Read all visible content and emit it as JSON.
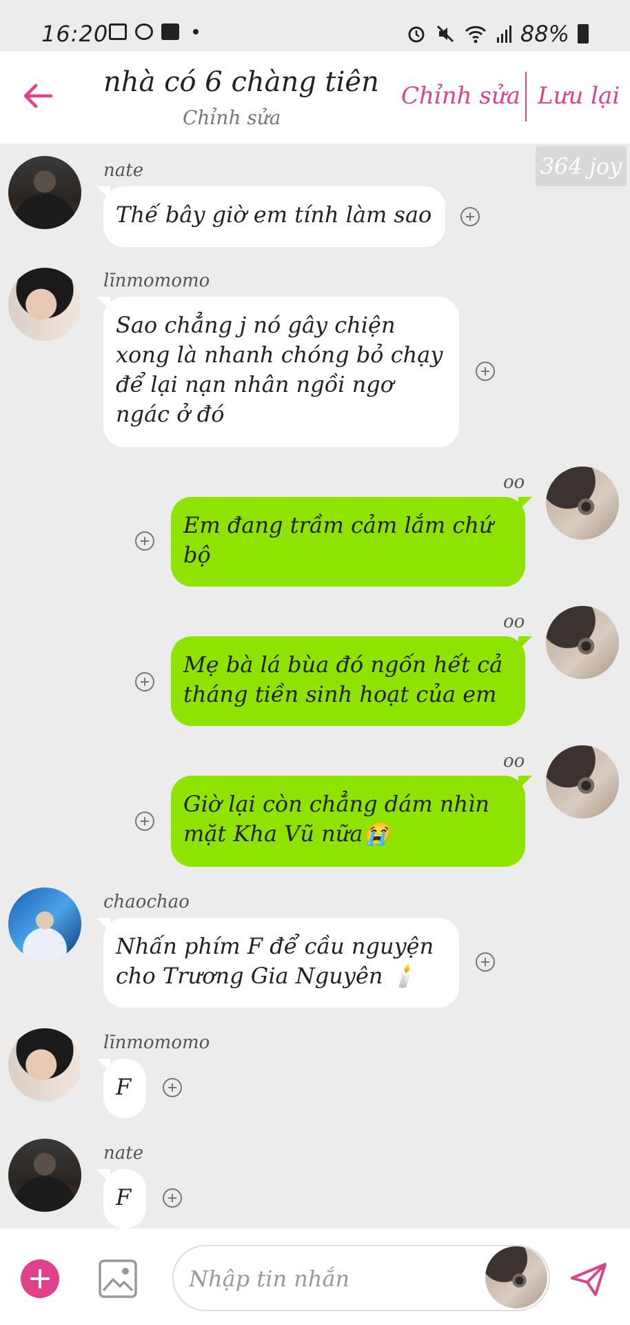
{
  "status_bar": {
    "time": "16:20",
    "battery": "88%"
  },
  "header": {
    "title": "nhà có 6 chàng tiên",
    "subtitle": "Chỉnh sửa",
    "edit_button": "Chỉnh sửa",
    "save_button": "Lưu lại"
  },
  "badge": "364 joy",
  "messages": [
    {
      "sender": "nate",
      "text": "Thế bây giờ em tính làm sao"
    },
    {
      "sender": "līnmomomo",
      "lines": [
        "Sao chẳng j nó gây chiện",
        "xong là nhanh chóng bỏ chạy",
        "để lại nạn nhân ngồi ngơ",
        "ngác ở đó"
      ]
    },
    {
      "sender": "oo",
      "lines": [
        "Em đang trầm cảm lắm chứ",
        "bộ"
      ]
    },
    {
      "sender": "oo",
      "lines": [
        "Mẹ bà lá bùa đó ngốn hết cả",
        "tháng tiền sinh hoạt của em"
      ]
    },
    {
      "sender": "oo",
      "lines": [
        "Giờ lại còn chẳng dám nhìn",
        "mặt Kha Vũ nữa😭"
      ]
    },
    {
      "sender": "chaochao",
      "lines": [
        "Nhấn phím F để cầu nguyện",
        "cho Trương Gia Nguyên 🕯️"
      ]
    },
    {
      "sender": "līnmomomo",
      "text": "F"
    },
    {
      "sender": "nate",
      "text": "F"
    }
  ],
  "composer": {
    "placeholder": "Nhập tin nhắn"
  },
  "colors": {
    "accent": "#e0418a",
    "own_bubble": "#8ee400",
    "other_bubble": "#ffffff"
  }
}
